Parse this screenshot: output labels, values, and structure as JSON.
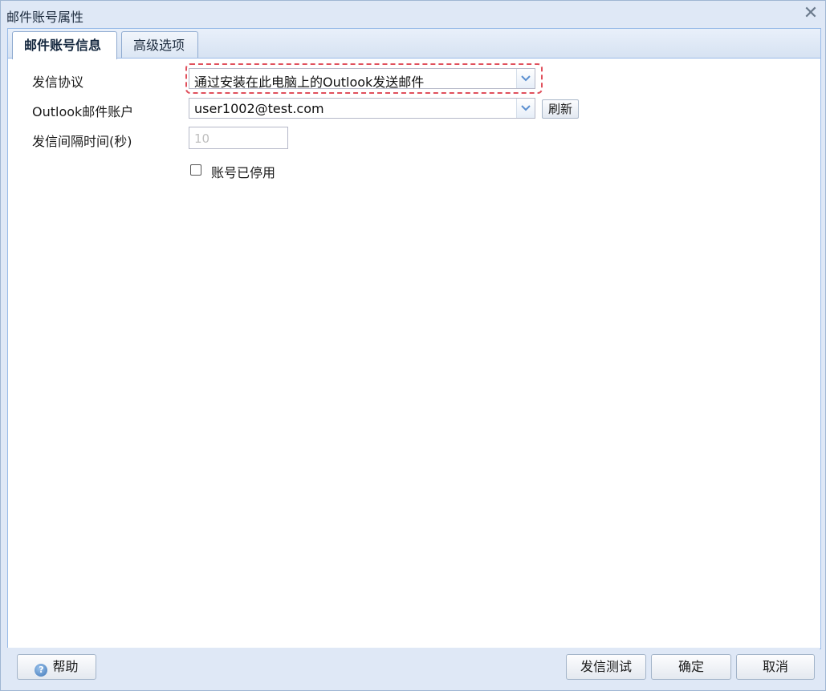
{
  "window": {
    "title": "邮件账号属性",
    "close_icon": "close-icon"
  },
  "tabs": [
    {
      "label": "邮件账号信息",
      "active": true
    },
    {
      "label": "高级选项",
      "active": false
    }
  ],
  "form": {
    "protocol_label": "发信协议",
    "protocol_value": "通过安装在此电脑上的Outlook发送邮件",
    "account_label": "Outlook邮件账户",
    "account_value": "user1002@test.com",
    "refresh_label": "刷新",
    "interval_label": "发信间隔时间(秒)",
    "interval_value": "10",
    "disabled_label": "账号已停用",
    "disabled_checked": false
  },
  "footer": {
    "help_label": "帮助",
    "test_label": "发信测试",
    "ok_label": "确定",
    "cancel_label": "取消"
  },
  "colors": {
    "accent": "#dfe8f6",
    "border": "#99bbe8",
    "highlight": "#e0505c"
  }
}
